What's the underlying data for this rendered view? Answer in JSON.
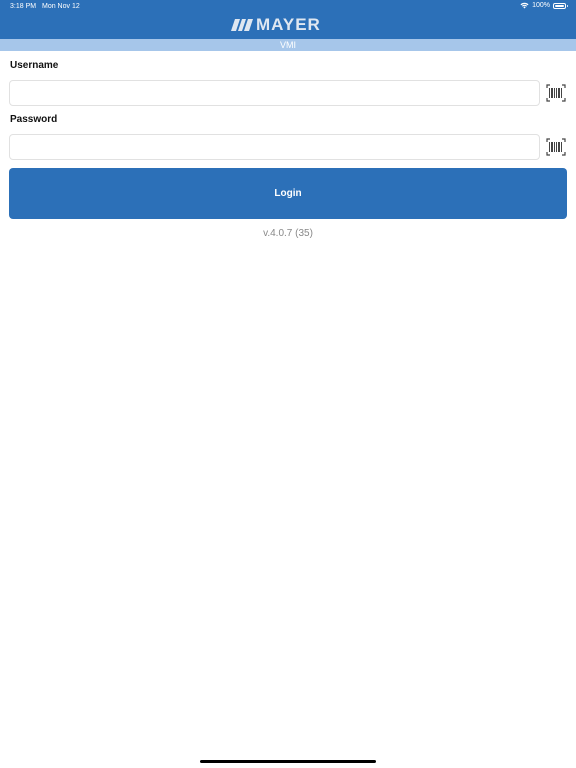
{
  "status_bar": {
    "time": "3:18 PM",
    "date": "Mon Nov 12",
    "battery": "100%",
    "battery_level": 1.0
  },
  "header": {
    "logo_text": "MAYER",
    "subtitle": "VMI",
    "background_color": "#2c70b8",
    "subheader_color": "#a6c6ea"
  },
  "form": {
    "username_label": "Username",
    "username_value": "",
    "password_label": "Password",
    "password_value": "",
    "scan_icon": "barcode-scan-icon",
    "login_label": "Login"
  },
  "footer": {
    "version": "v.4.0.7 (35)"
  }
}
